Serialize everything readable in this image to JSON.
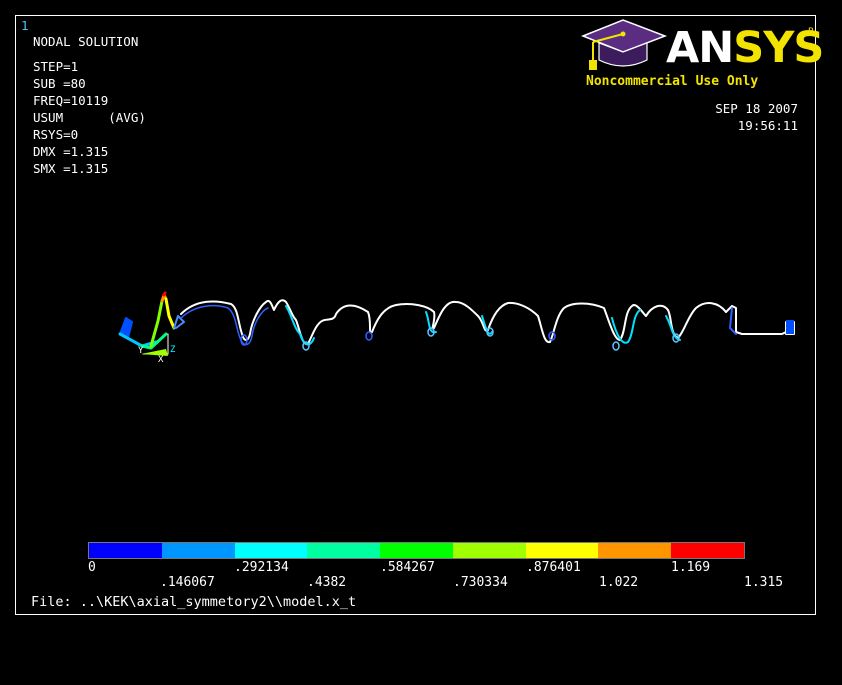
{
  "window_number": "1",
  "title": "NODAL SOLUTION",
  "info_lines": [
    "STEP=1",
    "SUB =80",
    "FREQ=10119",
    "USUM      (AVG)",
    "RSYS=0",
    "DMX =1.315",
    "SMX =1.315"
  ],
  "logo": {
    "an": "AN",
    "sys": "SYS",
    "reg": "R",
    "tagline": "Noncommercial Use Only"
  },
  "date": "SEP 18 2007",
  "time": "19:56:11",
  "triad": {
    "x": "X",
    "y": "Y",
    "z": "Z"
  },
  "legend": {
    "colors": [
      "#0000ff",
      "#0096ff",
      "#00ffff",
      "#00ffa0",
      "#00ff00",
      "#a0ff00",
      "#ffff00",
      "#ff9600",
      "#ff0000"
    ],
    "labels_top": [
      "0",
      ".292134",
      ".584267",
      ".876401",
      "1.169"
    ],
    "labels_bottom": [
      ".146067",
      ".4382",
      ".730334",
      "1.022",
      "1.315"
    ]
  },
  "file_line": "File: ..\\KEK\\axial_symmetory2\\\\model.x_t"
}
